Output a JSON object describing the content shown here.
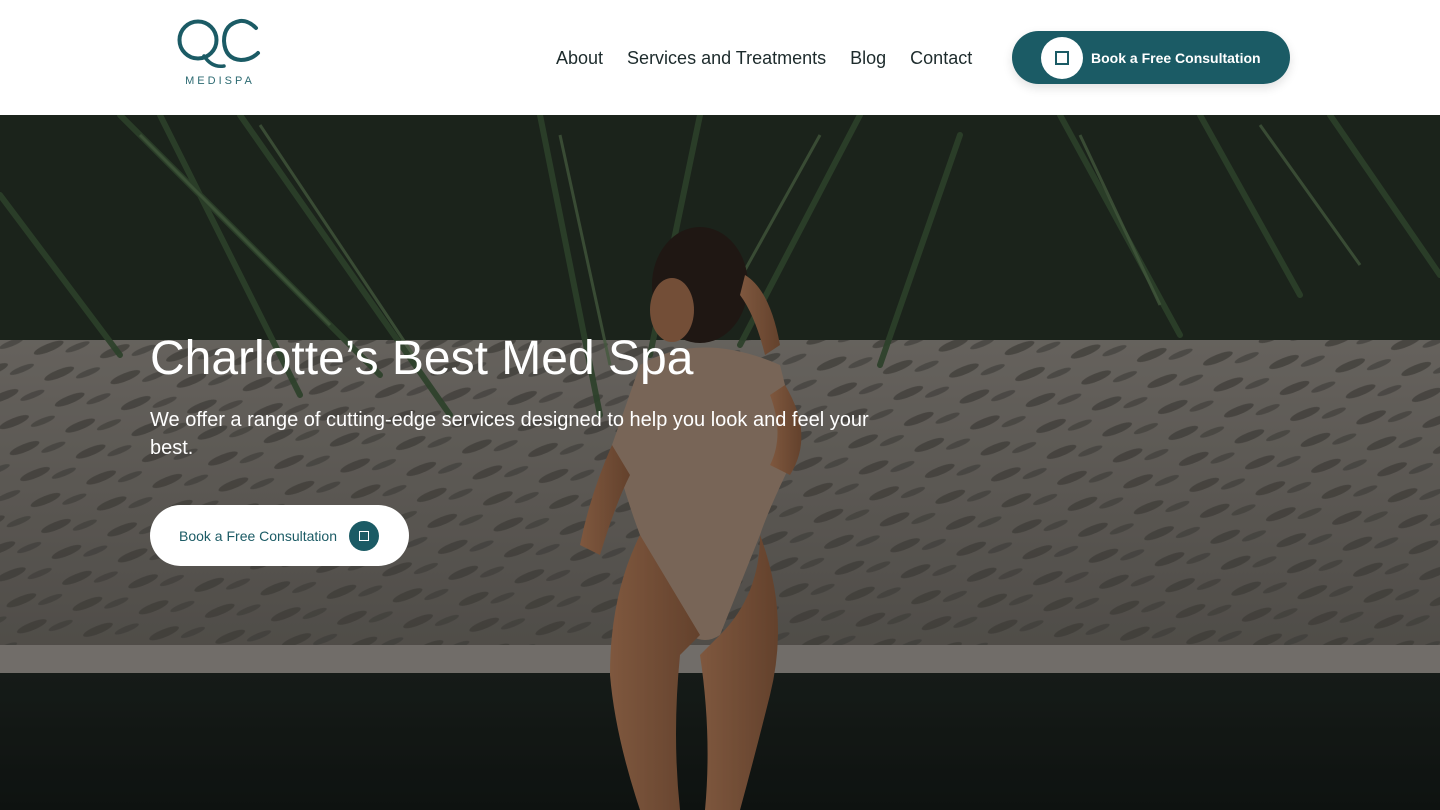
{
  "brand": {
    "logo_mark": "QC",
    "logo_word": "MEDISPA",
    "color": "#1b5b65"
  },
  "nav": {
    "items": [
      {
        "label": "About"
      },
      {
        "label": "Services and Treatments"
      },
      {
        "label": "Blog"
      },
      {
        "label": "Contact"
      }
    ]
  },
  "header_cta": {
    "label": "Book a Free Consultation",
    "icon": "square-icon"
  },
  "hero": {
    "title": "Charlotte’s Best Med Spa",
    "subtitle": "We offer a range of cutting-edge services designed to help you look and feel your best.",
    "cta_label": "Book a Free Consultation",
    "cta_icon": "square-icon",
    "image": "woman-in-swimsuit-under-palm-leaves"
  }
}
